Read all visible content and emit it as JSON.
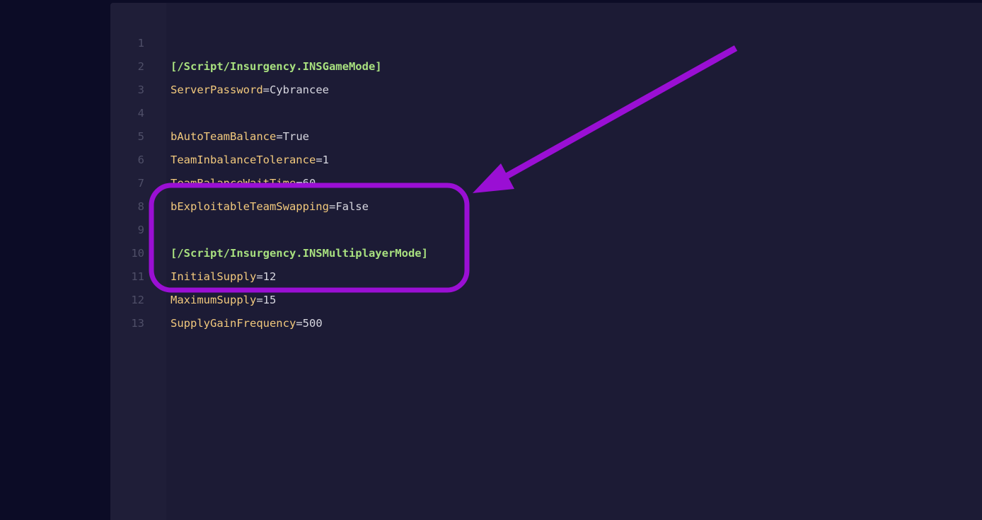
{
  "editor": {
    "lines": [
      {
        "number": "1",
        "section": "[/Script/Insurgency.INSGameMode]"
      },
      {
        "number": "2",
        "key": "ServerPassword",
        "op": "=",
        "value": "Cybrancee"
      },
      {
        "number": "3"
      },
      {
        "number": "4",
        "key": "bAutoTeamBalance",
        "op": "=",
        "value": "True"
      },
      {
        "number": "5",
        "key": "TeamInbalanceTolerance",
        "op": "=",
        "value": "1"
      },
      {
        "number": "6",
        "key": "TeamBalanceWaitTime",
        "op": "=",
        "value": "60"
      },
      {
        "number": "7",
        "key": "bExploitableTeamSwapping",
        "op": "=",
        "value": "False"
      },
      {
        "number": "8"
      },
      {
        "number": "9",
        "section": "[/Script/Insurgency.INSMultiplayerMode]"
      },
      {
        "number": "10",
        "key": "InitialSupply",
        "op": "=",
        "value": "12"
      },
      {
        "number": "11",
        "key": "MaximumSupply",
        "op": "=",
        "value": "15"
      },
      {
        "number": "12",
        "key": "SupplyGainFrequency",
        "op": "=",
        "value": "500"
      },
      {
        "number": "13"
      }
    ]
  },
  "annotation": {
    "color": "#9a0fd4",
    "shapes": [
      "highlight-box",
      "arrow"
    ]
  }
}
